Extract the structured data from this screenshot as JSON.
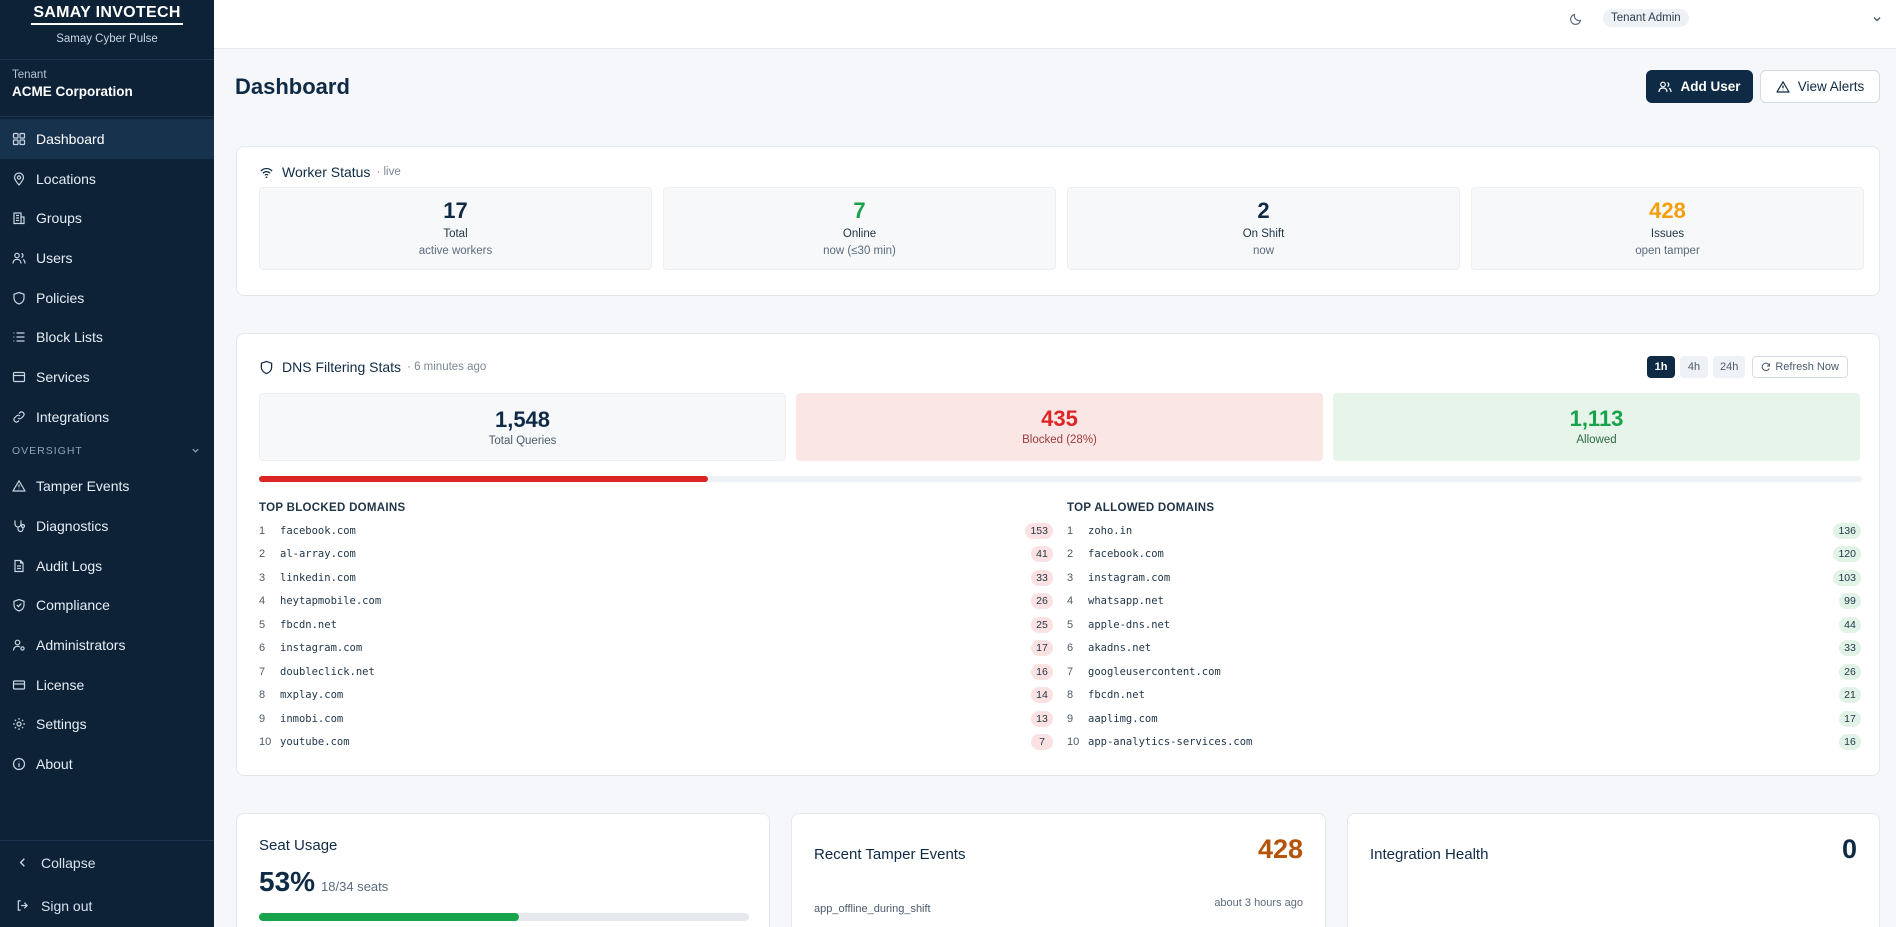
{
  "sidebar": {
    "brand": "SAMAY INVOTECH",
    "product": "Samay Cyber Pulse",
    "tenant_label": "Tenant",
    "tenant_name": "ACME Corporation",
    "items": [
      {
        "label": "Dashboard",
        "icon": "grid-icon",
        "active": true
      },
      {
        "label": "Locations",
        "icon": "map-pin-icon"
      },
      {
        "label": "Groups",
        "icon": "building-icon"
      },
      {
        "label": "Users",
        "icon": "users-icon"
      },
      {
        "label": "Policies",
        "icon": "shield-icon"
      },
      {
        "label": "Block Lists",
        "icon": "list-icon"
      },
      {
        "label": "Services",
        "icon": "box-icon"
      },
      {
        "label": "Integrations",
        "icon": "link-icon"
      }
    ],
    "section_label": "OVERSIGHT",
    "oversight_items": [
      {
        "label": "Tamper Events",
        "icon": "alert-triangle-icon"
      },
      {
        "label": "Diagnostics",
        "icon": "stethoscope-icon"
      },
      {
        "label": "Audit Logs",
        "icon": "file-text-icon"
      },
      {
        "label": "Compliance",
        "icon": "shield-check-icon"
      },
      {
        "label": "Administrators",
        "icon": "user-cog-icon"
      },
      {
        "label": "License",
        "icon": "credit-card-icon"
      },
      {
        "label": "Settings",
        "icon": "gear-icon"
      },
      {
        "label": "About",
        "icon": "info-icon"
      }
    ],
    "collapse_label": "Collapse",
    "signout_label": "Sign out"
  },
  "topbar": {
    "role": "Tenant Admin"
  },
  "header": {
    "title": "Dashboard",
    "add_user_label": "Add User",
    "view_alerts_label": "View Alerts"
  },
  "worker_status": {
    "title": "Worker Status",
    "tag": "· live",
    "stats": [
      {
        "value": "17",
        "label": "Total",
        "sub": "active workers",
        "color": "#0f2a44"
      },
      {
        "value": "7",
        "label": "Online",
        "sub": "now (≤30 min)",
        "color": "#16a34a"
      },
      {
        "value": "2",
        "label": "On Shift",
        "sub": "now",
        "color": "#0f2a44"
      },
      {
        "value": "428",
        "label": "Issues",
        "sub": "open tamper",
        "color": "#f59e0b"
      }
    ]
  },
  "dns": {
    "title": "DNS Filtering Stats",
    "updated": "· 6 minutes ago",
    "ranges": [
      "1h",
      "4h",
      "24h"
    ],
    "selected_range": "1h",
    "refresh_label": "Refresh Now",
    "total": "1,548",
    "total_label": "Total Queries",
    "blocked": "435",
    "blocked_label": "Blocked (28%)",
    "allowed": "1,113",
    "allowed_label": "Allowed",
    "blocked_ratio": 0.28,
    "blocked_header": "TOP BLOCKED DOMAINS",
    "allowed_header": "TOP ALLOWED DOMAINS",
    "top_blocked": [
      {
        "rank": "1",
        "domain": "facebook.com",
        "count": "153"
      },
      {
        "rank": "2",
        "domain": "al-array.com",
        "count": "41"
      },
      {
        "rank": "3",
        "domain": "linkedin.com",
        "count": "33"
      },
      {
        "rank": "4",
        "domain": "heytapmobile.com",
        "count": "26"
      },
      {
        "rank": "5",
        "domain": "fbcdn.net",
        "count": "25"
      },
      {
        "rank": "6",
        "domain": "instagram.com",
        "count": "17"
      },
      {
        "rank": "7",
        "domain": "doubleclick.net",
        "count": "16"
      },
      {
        "rank": "8",
        "domain": "mxplay.com",
        "count": "14"
      },
      {
        "rank": "9",
        "domain": "inmobi.com",
        "count": "13"
      },
      {
        "rank": "10",
        "domain": "youtube.com",
        "count": "7"
      }
    ],
    "top_allowed": [
      {
        "rank": "1",
        "domain": "zoho.in",
        "count": "136"
      },
      {
        "rank": "2",
        "domain": "facebook.com",
        "count": "120"
      },
      {
        "rank": "3",
        "domain": "instagram.com",
        "count": "103"
      },
      {
        "rank": "4",
        "domain": "whatsapp.net",
        "count": "99"
      },
      {
        "rank": "5",
        "domain": "apple-dns.net",
        "count": "44"
      },
      {
        "rank": "6",
        "domain": "akadns.net",
        "count": "33"
      },
      {
        "rank": "7",
        "domain": "googleusercontent.com",
        "count": "26"
      },
      {
        "rank": "8",
        "domain": "fbcdn.net",
        "count": "21"
      },
      {
        "rank": "9",
        "domain": "aaplimg.com",
        "count": "17"
      },
      {
        "rank": "10",
        "domain": "app-analytics-services.com",
        "count": "16"
      }
    ]
  },
  "seat_usage": {
    "title": "Seat Usage",
    "percent": "53%",
    "seats": "18/34 seats",
    "ratio": 0.53
  },
  "tamper": {
    "title": "Recent Tamper Events",
    "count": "428",
    "event": "app_offline_during_shift",
    "time": "about 3 hours ago"
  },
  "integration": {
    "title": "Integration Health",
    "count": "0"
  }
}
